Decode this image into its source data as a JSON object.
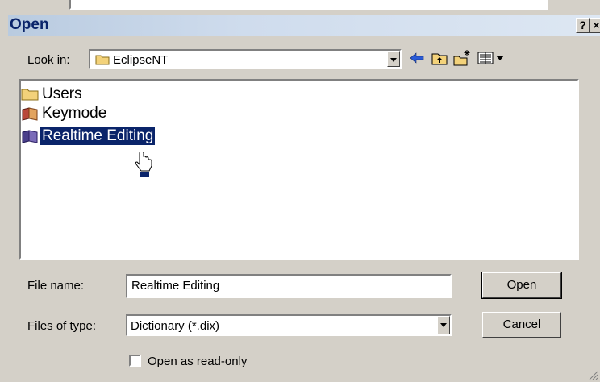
{
  "dialog": {
    "title": "Open",
    "help_glyph": "?",
    "close_glyph": "×"
  },
  "look_in": {
    "label": "Look in:",
    "value": "EclipseNT"
  },
  "toolbar": {
    "icons": [
      "back-icon",
      "up-one-level-icon",
      "create-new-folder-icon",
      "view-menu-icon"
    ]
  },
  "files": [
    {
      "name": "Users",
      "icon": "folder-icon",
      "selected": false
    },
    {
      "name": "Keymode",
      "icon": "dictionary-book-icon",
      "selected": false
    },
    {
      "name": "Realtime Editing",
      "icon": "dictionary-book-icon",
      "selected": true
    }
  ],
  "file_name": {
    "label": "File name:",
    "value": "Realtime Editing"
  },
  "file_type": {
    "label": "Files of type:",
    "value": "Dictionary (*.dix)"
  },
  "buttons": {
    "open": "Open",
    "cancel": "Cancel"
  },
  "read_only": {
    "label": "Open as read-only",
    "checked": false
  },
  "colors": {
    "selection": "#0a246a",
    "title_text": "#0a246a",
    "face": "#d4d0c8"
  }
}
